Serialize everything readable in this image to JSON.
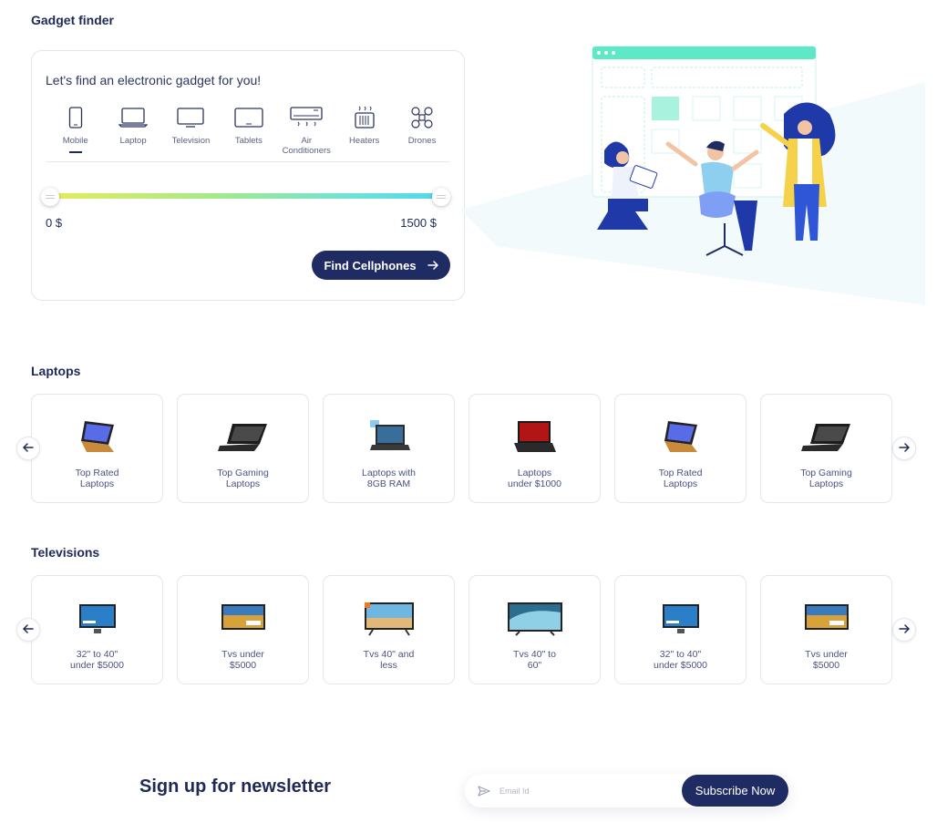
{
  "finder": {
    "title": "Gadget finder",
    "prompt": "Let's find an electronic gadget for you!",
    "categories": [
      {
        "label": "Mobile",
        "icon": "mobile-icon",
        "active": true
      },
      {
        "label": "Laptop",
        "icon": "laptop-icon"
      },
      {
        "label": "Television",
        "icon": "television-icon"
      },
      {
        "label": "Tablets",
        "icon": "tablet-icon"
      },
      {
        "label": "Air\nConditioners",
        "icon": "air-conditioner-icon"
      },
      {
        "label": "Heaters",
        "icon": "heater-icon"
      },
      {
        "label": "Drones",
        "icon": "drone-icon"
      }
    ],
    "price_min": "0 $",
    "price_max": "1500 $",
    "button_label": "Find Cellphones"
  },
  "laptops": {
    "title": "Laptops",
    "items": [
      {
        "label": "Top Rated\nLaptops"
      },
      {
        "label": "Top Gaming\nLaptops"
      },
      {
        "label": "Laptops with\n8GB RAM"
      },
      {
        "label": "Laptops\nunder $1000"
      },
      {
        "label": "Top Rated\nLaptops"
      },
      {
        "label": "Top Gaming\nLaptops"
      }
    ]
  },
  "televisions": {
    "title": "Televisions",
    "items": [
      {
        "label": "32\" to 40\"\nunder $5000"
      },
      {
        "label": "Tvs under\n$5000"
      },
      {
        "label": "Tvs 40\" and\nless"
      },
      {
        "label": "Tvs 40\" to\n60\""
      },
      {
        "label": "32\" to 40\"\nunder $5000"
      },
      {
        "label": "Tvs under\n$5000"
      }
    ]
  },
  "newsletter": {
    "title": "Sign up for newsletter",
    "placeholder": "Email Id",
    "button_label": "Subscribe Now"
  },
  "colors": {
    "primary": "#1f2b63",
    "accent": "#5de8c6"
  }
}
